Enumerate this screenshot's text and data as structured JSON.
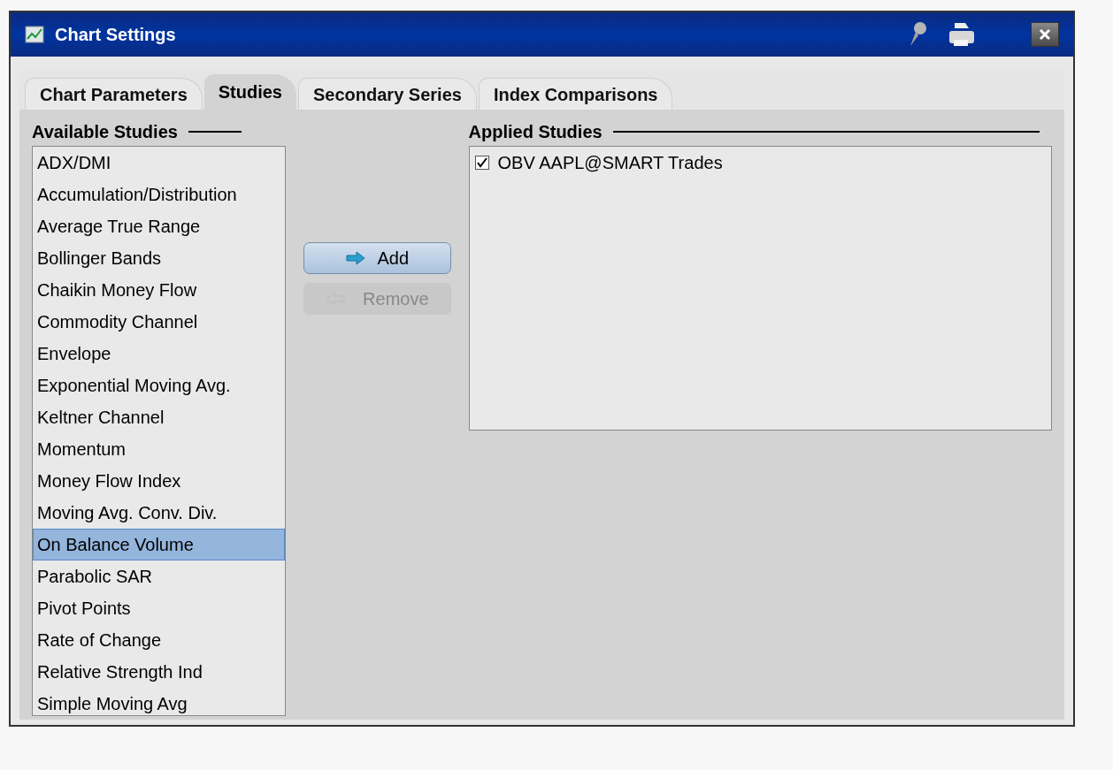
{
  "window": {
    "title": "Chart Settings"
  },
  "tabs": [
    {
      "label": "Chart Parameters",
      "selected": false
    },
    {
      "label": "Studies",
      "selected": true
    },
    {
      "label": "Secondary Series",
      "selected": false
    },
    {
      "label": "Index Comparisons",
      "selected": false
    }
  ],
  "available": {
    "heading": "Available Studies",
    "items": [
      {
        "label": "ADX/DMI",
        "selected": false
      },
      {
        "label": "Accumulation/Distribution",
        "selected": false
      },
      {
        "label": "Average True Range",
        "selected": false
      },
      {
        "label": "Bollinger Bands",
        "selected": false
      },
      {
        "label": "Chaikin Money Flow",
        "selected": false
      },
      {
        "label": "Commodity Channel",
        "selected": false
      },
      {
        "label": "Envelope",
        "selected": false
      },
      {
        "label": "Exponential Moving Avg.",
        "selected": false
      },
      {
        "label": "Keltner Channel",
        "selected": false
      },
      {
        "label": "Momentum",
        "selected": false
      },
      {
        "label": "Money Flow Index",
        "selected": false
      },
      {
        "label": "Moving Avg. Conv. Div.",
        "selected": false
      },
      {
        "label": "On Balance Volume",
        "selected": true
      },
      {
        "label": "Parabolic SAR",
        "selected": false
      },
      {
        "label": "Pivot Points",
        "selected": false
      },
      {
        "label": "Rate of Change",
        "selected": false
      },
      {
        "label": "Relative Strength Ind",
        "selected": false
      },
      {
        "label": "Simple Moving Avg",
        "selected": false
      }
    ]
  },
  "buttons": [
    {
      "label": "Add",
      "disabled": false
    },
    {
      "label": "Remove",
      "disabled": true
    }
  ],
  "applied": {
    "heading": "Applied Studies",
    "items": [
      {
        "label": "OBV AAPL@SMART Trades",
        "checked": true
      }
    ]
  }
}
